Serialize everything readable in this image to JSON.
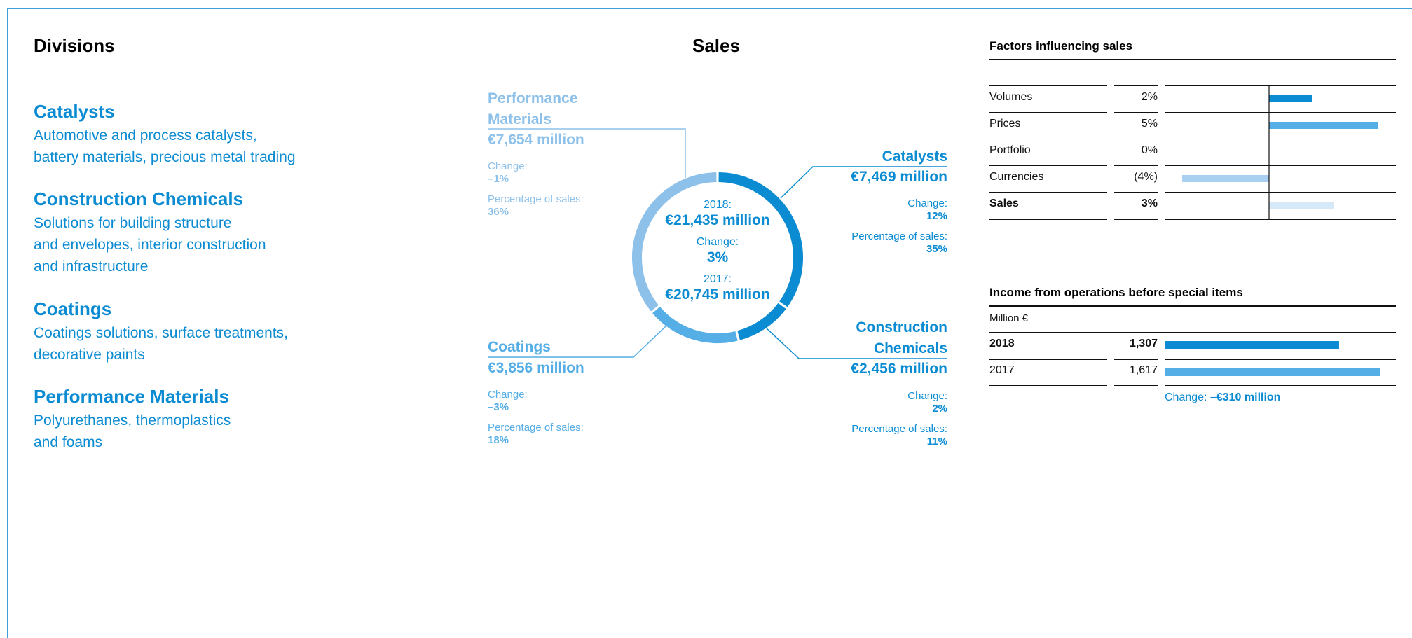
{
  "divisions": {
    "heading": "Divisions",
    "items": [
      {
        "name": "Catalysts",
        "desc1": "Automotive and process catalysts,",
        "desc2": "battery materials, precious metal trading",
        "desc3": ""
      },
      {
        "name": "Construction Chemicals",
        "desc1": "Solutions for building structure",
        "desc2": "and envelopes, interior construction",
        "desc3": "and infrastructure"
      },
      {
        "name": "Coatings",
        "desc1": "Coatings solutions, surface treatments,",
        "desc2": "decorative paints",
        "desc3": ""
      },
      {
        "name": "Performance Materials",
        "desc1": "Polyurethanes, thermoplastics",
        "desc2": "and foams",
        "desc3": ""
      }
    ]
  },
  "sales": {
    "heading": "Sales",
    "center": {
      "year1_label": "2018:",
      "year1_value": "€21,435 million",
      "change_label": "Change:",
      "change_value": "3%",
      "year2_label": "2017:",
      "year2_value": "€20,745 million"
    },
    "segments": [
      {
        "title1": "Performance",
        "title2": "Materials",
        "value": "€7,654 million",
        "change_label": "Change:",
        "change": "–1%",
        "pct_label": "Percentage of sales:",
        "pct": "36%"
      },
      {
        "title1": "Catalysts",
        "title2": "",
        "value": "€7,469 million",
        "change_label": "Change:",
        "change": "12%",
        "pct_label": "Percentage of sales:",
        "pct": "35%"
      },
      {
        "title1": "Construction",
        "title2": "Chemicals",
        "value": "€2,456 million",
        "change_label": "Change:",
        "change": "2%",
        "pct_label": "Percentage of sales:",
        "pct": "11%"
      },
      {
        "title1": "Coatings",
        "title2": "",
        "value": "€3,856 million",
        "change_label": "Change:",
        "change": "–3%",
        "pct_label": "Percentage of sales:",
        "pct": "18%"
      }
    ]
  },
  "factors": {
    "title": "Factors influencing sales",
    "rows": [
      {
        "label": "Volumes",
        "value": "2%"
      },
      {
        "label": "Prices",
        "value": "5%"
      },
      {
        "label": "Portfolio",
        "value": "0%"
      },
      {
        "label": "Currencies",
        "value": "(4%)"
      },
      {
        "label": "Sales",
        "value": "3%"
      }
    ]
  },
  "income": {
    "title": "Income from operations before special items",
    "unit": "Million €",
    "rows": [
      {
        "label": "2018",
        "value": "1,307"
      },
      {
        "label": "2017",
        "value": "1,617"
      }
    ],
    "change_label": "Change:",
    "change_value": "–€310 million"
  },
  "colors": {
    "dark": "#0a8bd2",
    "mid": "#55aee5",
    "light": "#8ec1ea",
    "pale": "#d6e9f8",
    "currency_bar": "#a9d0f0"
  },
  "chart_data": [
    {
      "type": "pie",
      "title": "Sales",
      "categories": [
        "Catalysts",
        "Construction Chemicals",
        "Coatings",
        "Performance Materials"
      ],
      "values": [
        35,
        11,
        18,
        36
      ],
      "unit": "Percentage of sales"
    },
    {
      "type": "bar",
      "title": "Factors influencing sales",
      "categories": [
        "Volumes",
        "Prices",
        "Portfolio",
        "Currencies",
        "Sales"
      ],
      "values": [
        2,
        5,
        0,
        -4,
        3
      ],
      "unit": "%"
    },
    {
      "type": "bar",
      "title": "Income from operations before special items",
      "categories": [
        "2018",
        "2017"
      ],
      "values": [
        1307,
        1617
      ],
      "unit": "Million €"
    }
  ]
}
